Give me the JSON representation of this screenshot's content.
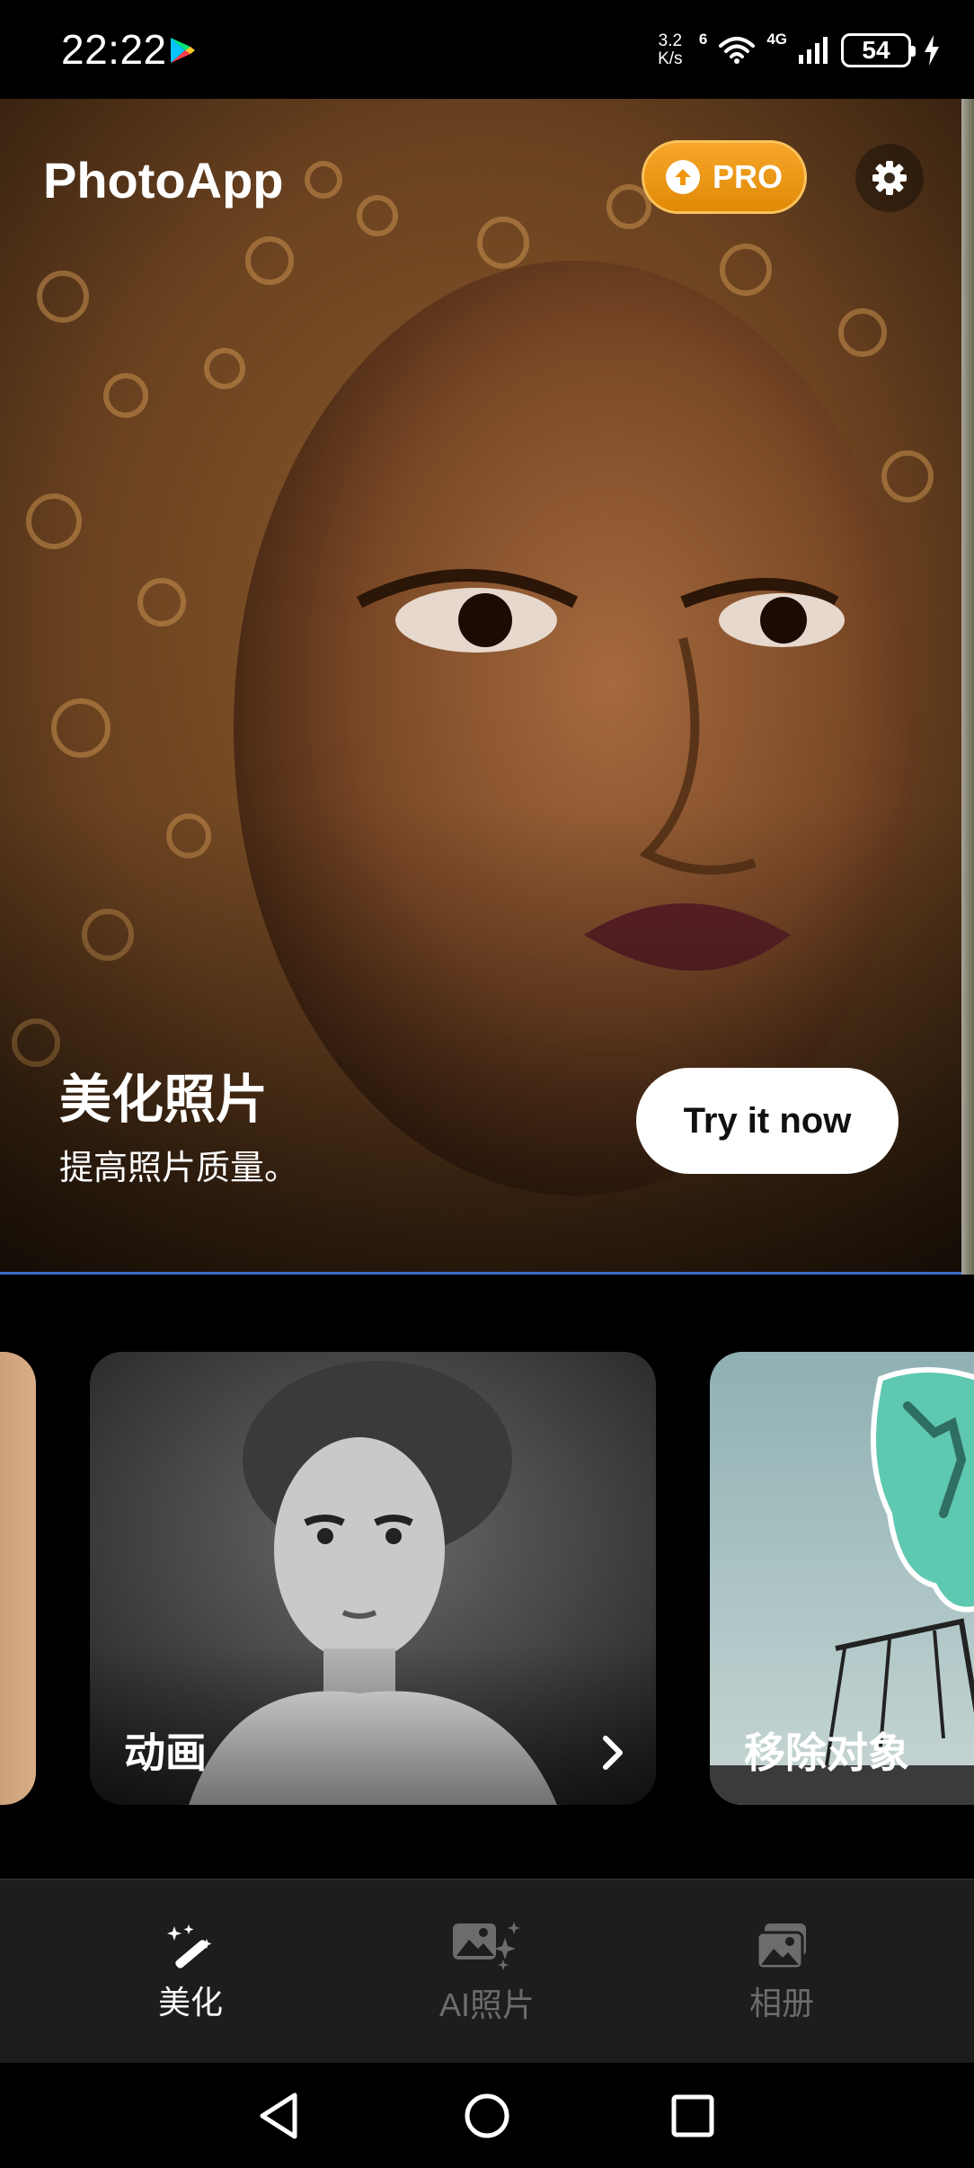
{
  "status_bar": {
    "time": "22:22",
    "net_speed_top": "3.2",
    "net_speed_bottom": "K/s",
    "wifi_label": "6",
    "cell_label": "4G",
    "battery": "54"
  },
  "header": {
    "app_title": "PhotoApp",
    "pro_label": "PRO",
    "icons": [
      "upgrade-arrow-icon",
      "gear-icon"
    ]
  },
  "hero": {
    "title": "美化照片",
    "subtitle": "提高照片质量。",
    "cta_label": "Try it now"
  },
  "cards": [
    {
      "label": "动画"
    },
    {
      "label": "移除对象"
    }
  ],
  "bottom_nav": {
    "items": [
      {
        "label": "美化",
        "icon": "magic-wand-icon",
        "active": true
      },
      {
        "label": "AI照片",
        "icon": "ai-photo-icon",
        "active": false
      },
      {
        "label": "相册",
        "icon": "album-icon",
        "active": false
      }
    ]
  },
  "colors": {
    "pro_button": "#f0960e",
    "nav_active": "#ffffff",
    "nav_inactive": "#6c6c6c",
    "hero_underline": "#3f6dc9"
  }
}
